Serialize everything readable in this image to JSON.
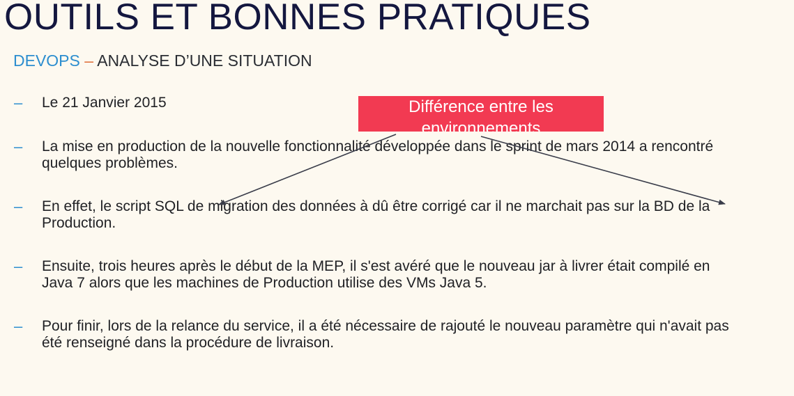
{
  "slide": {
    "title": "OUTILS ET BONNES PRATIQUES",
    "subtitle": {
      "accent": "DEVOPS",
      "separator": "–",
      "rest": "ANALYSE D’UNE SITUATION"
    },
    "bullet_marker": "–",
    "bullets": [
      "Le 21 Janvier 2015",
      "La mise en production de la nouvelle fonctionnalité développée dans le sprint de mars 2014 a rencontré quelques problèmes.",
      "En effet, le script SQL de migration des données à dû être corrigé car il ne marchait pas sur la BD de la Production.",
      "Ensuite, trois heures après le début de la MEP, il s'est avéré que le nouveau jar à livrer était compilé en Java 7 alors que les machines de Production utilise des VMs Java 5.",
      "Pour finir, lors de la relance du service, il a été nécessaire de rajouté le nouveau paramètre qui n'avait pas été renseigné dans la procédure de livraison."
    ],
    "callout": "Différence entre les environnements",
    "colors": {
      "background": "#fdf9f0",
      "title": "#14173f",
      "accent": "#2d8ecf",
      "callout": "#f23a52",
      "arrow": "#3a3d4a"
    }
  }
}
